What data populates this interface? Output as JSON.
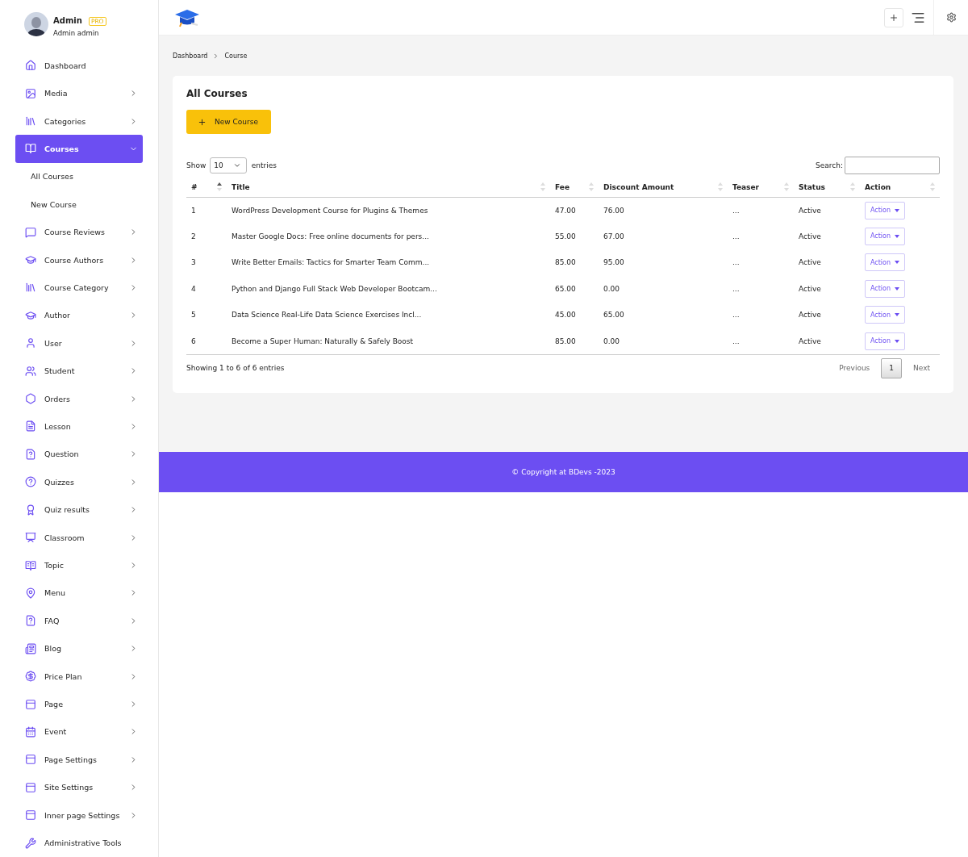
{
  "profile": {
    "name": "Admin",
    "badge": "PRO",
    "subtitle": "Admin admin"
  },
  "sidebar": {
    "items": [
      {
        "label": "Dashboard",
        "selected": false
      },
      {
        "label": "Media",
        "selected": false,
        "expanded": false
      },
      {
        "label": "Categories",
        "selected": false,
        "expanded": false
      },
      {
        "label": "Courses",
        "selected": true,
        "expanded": true,
        "children": [
          {
            "label": "All Courses"
          },
          {
            "label": "New Course"
          }
        ]
      },
      {
        "label": "Course Reviews",
        "selected": false,
        "expanded": false
      },
      {
        "label": "Course Authors",
        "selected": false,
        "expanded": false
      },
      {
        "label": "Course Category",
        "selected": false,
        "expanded": false
      },
      {
        "label": "Author",
        "selected": false,
        "expanded": false
      },
      {
        "label": "User",
        "selected": false,
        "expanded": false
      },
      {
        "label": "Student",
        "selected": false,
        "expanded": false
      },
      {
        "label": "Orders",
        "selected": false,
        "expanded": false
      },
      {
        "label": "Lesson",
        "selected": false,
        "expanded": false
      },
      {
        "label": "Question",
        "selected": false,
        "expanded": false
      },
      {
        "label": "Quizzes",
        "selected": false,
        "expanded": false
      },
      {
        "label": "Quiz results",
        "selected": false,
        "expanded": false
      },
      {
        "label": "Classroom",
        "selected": false,
        "expanded": false
      },
      {
        "label": "Topic",
        "selected": false,
        "expanded": false
      },
      {
        "label": "Menu",
        "selected": false,
        "expanded": false
      },
      {
        "label": "FAQ",
        "selected": false,
        "expanded": false
      },
      {
        "label": "Blog",
        "selected": false,
        "expanded": false
      },
      {
        "label": "Price Plan",
        "selected": false,
        "expanded": false
      },
      {
        "label": "Page",
        "selected": false,
        "expanded": false
      },
      {
        "label": "Event",
        "selected": false,
        "expanded": false
      },
      {
        "label": "Page Settings",
        "selected": false,
        "expanded": false
      },
      {
        "label": "Site Settings",
        "selected": false,
        "expanded": false
      },
      {
        "label": "Inner page Settings",
        "selected": false,
        "expanded": false
      },
      {
        "label": "Administrative Tools",
        "selected": false
      }
    ]
  },
  "breadcrumb": [
    "Dashboard",
    "Course"
  ],
  "card": {
    "title": "All Courses",
    "new_button": "New Course",
    "length": {
      "label_before": "Show",
      "value": "10",
      "label_after": "entries"
    },
    "search": {
      "label": "Search:"
    },
    "table": {
      "columns": [
        {
          "label": "#",
          "sorted": true
        },
        {
          "label": "Title",
          "sorted": false
        },
        {
          "label": "Fee",
          "sorted": false
        },
        {
          "label": "Discount Amount",
          "sorted": false
        },
        {
          "label": "Teaser",
          "sorted": false
        },
        {
          "label": "Status",
          "sorted": false
        },
        {
          "label": "Action",
          "sorted": false
        }
      ],
      "rows": [
        {
          "num": "1",
          "title": "WordPress Development Course for Plugins & Themes",
          "fee": "47.00",
          "discount": "76.00",
          "teaser": "...",
          "status": "Active",
          "action": "Action"
        },
        {
          "num": "2",
          "title": "Master Google Docs: Free online documents for pers...",
          "fee": "55.00",
          "discount": "67.00",
          "teaser": "...",
          "status": "Active",
          "action": "Action"
        },
        {
          "num": "3",
          "title": "Write Better Emails: Tactics for Smarter Team Comm...",
          "fee": "85.00",
          "discount": "95.00",
          "teaser": "...",
          "status": "Active",
          "action": "Action"
        },
        {
          "num": "4",
          "title": "Python and Django Full Stack Web Developer Bootcam...",
          "fee": "65.00",
          "discount": "0.00",
          "teaser": "...",
          "status": "Active",
          "action": "Action"
        },
        {
          "num": "5",
          "title": "Data Science Real-Life Data Science Exercises Incl...",
          "fee": "45.00",
          "discount": "65.00",
          "teaser": "...",
          "status": "Active",
          "action": "Action"
        },
        {
          "num": "6",
          "title": "Become a Super Human: Naturally & Safely Boost",
          "fee": "85.00",
          "discount": "0.00",
          "teaser": "...",
          "status": "Active",
          "action": "Action"
        }
      ]
    },
    "info": "Showing 1 to 6 of 6 entries",
    "pagination": [
      {
        "label": "Previous",
        "selected": false
      },
      {
        "label": "1",
        "selected": true
      },
      {
        "label": "Next",
        "selected": false
      }
    ]
  },
  "footer": "© Copyright at BDevs -2023"
}
